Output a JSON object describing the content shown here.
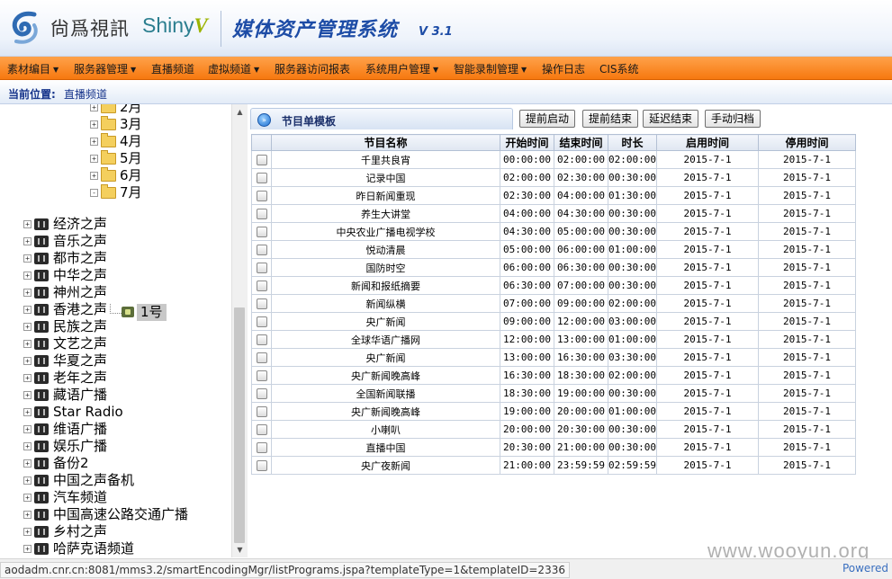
{
  "header": {
    "logo_cn": "尙爲視訊",
    "logo_en": "Shiny",
    "logo_v": "V",
    "system_title": "媒体资产管理系统",
    "version": "V 3.1"
  },
  "nav": {
    "items": [
      {
        "label": "素材编目",
        "dropdown": true
      },
      {
        "label": "服务器管理",
        "dropdown": true
      },
      {
        "label": "直播频道",
        "dropdown": false
      },
      {
        "label": "虚拟频道",
        "dropdown": true
      },
      {
        "label": "服务器访问报表",
        "dropdown": false
      },
      {
        "label": "系统用户管理",
        "dropdown": true
      },
      {
        "label": "智能录制管理",
        "dropdown": true
      },
      {
        "label": "操作日志",
        "dropdown": false
      },
      {
        "label": "CIS系统",
        "dropdown": false
      }
    ],
    "caret": "▼"
  },
  "breadcrumb": {
    "label": "当前位置:",
    "value": "直播频道"
  },
  "tree": {
    "months": [
      {
        "label": "2月",
        "expander": "+"
      },
      {
        "label": "3月",
        "expander": "+"
      },
      {
        "label": "4月",
        "expander": "+"
      },
      {
        "label": "5月",
        "expander": "+"
      },
      {
        "label": "6月",
        "expander": "+"
      },
      {
        "label": "7月",
        "expander": "-"
      }
    ],
    "selected_leaf": "1号",
    "channels": [
      "经济之声",
      "音乐之声",
      "都市之声",
      "中华之声",
      "神州之声",
      "香港之声",
      "民族之声",
      "文艺之声",
      "华夏之声",
      "老年之声",
      "藏语广播",
      "Star Radio",
      "维语广播",
      "娱乐广播",
      "备份2",
      "中国之声备机",
      "汽车频道",
      "中国高速公路交通广播",
      "乡村之声",
      "哈萨克语频道"
    ],
    "channel_expander": "+"
  },
  "scrollbar": {
    "up": "▲",
    "down": "▼"
  },
  "panel": {
    "tab_icon": "»",
    "title": "节目单模板",
    "buttons": [
      "提前启动",
      "提前结束",
      "延迟结束",
      "手动归档"
    ]
  },
  "table": {
    "headers": [
      "",
      "节目名称",
      "开始时间",
      "结束时间",
      "时长",
      "启用时间",
      "停用时间"
    ],
    "rows": [
      [
        "千里共良宵",
        "00:00:00",
        "02:00:00",
        "02:00:00",
        "2015-7-1",
        "2015-7-1"
      ],
      [
        "记录中国",
        "02:00:00",
        "02:30:00",
        "00:30:00",
        "2015-7-1",
        "2015-7-1"
      ],
      [
        "昨日新闻重现",
        "02:30:00",
        "04:00:00",
        "01:30:00",
        "2015-7-1",
        "2015-7-1"
      ],
      [
        "养生大讲堂",
        "04:00:00",
        "04:30:00",
        "00:30:00",
        "2015-7-1",
        "2015-7-1"
      ],
      [
        "中央农业广播电视学校",
        "04:30:00",
        "05:00:00",
        "00:30:00",
        "2015-7-1",
        "2015-7-1"
      ],
      [
        "悦动清晨",
        "05:00:00",
        "06:00:00",
        "01:00:00",
        "2015-7-1",
        "2015-7-1"
      ],
      [
        "国防时空",
        "06:00:00",
        "06:30:00",
        "00:30:00",
        "2015-7-1",
        "2015-7-1"
      ],
      [
        "新闻和报纸摘要",
        "06:30:00",
        "07:00:00",
        "00:30:00",
        "2015-7-1",
        "2015-7-1"
      ],
      [
        "新闻纵横",
        "07:00:00",
        "09:00:00",
        "02:00:00",
        "2015-7-1",
        "2015-7-1"
      ],
      [
        "央广新闻",
        "09:00:00",
        "12:00:00",
        "03:00:00",
        "2015-7-1",
        "2015-7-1"
      ],
      [
        "全球华语广播网",
        "12:00:00",
        "13:00:00",
        "01:00:00",
        "2015-7-1",
        "2015-7-1"
      ],
      [
        "央广新闻",
        "13:00:00",
        "16:30:00",
        "03:30:00",
        "2015-7-1",
        "2015-7-1"
      ],
      [
        "央广新闻晚高峰",
        "16:30:00",
        "18:30:00",
        "02:00:00",
        "2015-7-1",
        "2015-7-1"
      ],
      [
        "全国新闻联播",
        "18:30:00",
        "19:00:00",
        "00:30:00",
        "2015-7-1",
        "2015-7-1"
      ],
      [
        "央广新闻晚高峰",
        "19:00:00",
        "20:00:00",
        "01:00:00",
        "2015-7-1",
        "2015-7-1"
      ],
      [
        "小喇叭",
        "20:00:00",
        "20:30:00",
        "00:30:00",
        "2015-7-1",
        "2015-7-1"
      ],
      [
        "直播中国",
        "20:30:00",
        "21:00:00",
        "00:30:00",
        "2015-7-1",
        "2015-7-1"
      ],
      [
        "央广夜新闻",
        "21:00:00",
        "23:59:59",
        "02:59:59",
        "2015-7-1",
        "2015-7-1"
      ]
    ]
  },
  "status": {
    "url": "aodadm.cnr.cn:8081/mms3.2/smartEncodingMgr/listPrograms.jspa?templateType=1&templateID=2336",
    "powered": "Powered",
    "watermark": "www.wooyun.org"
  }
}
